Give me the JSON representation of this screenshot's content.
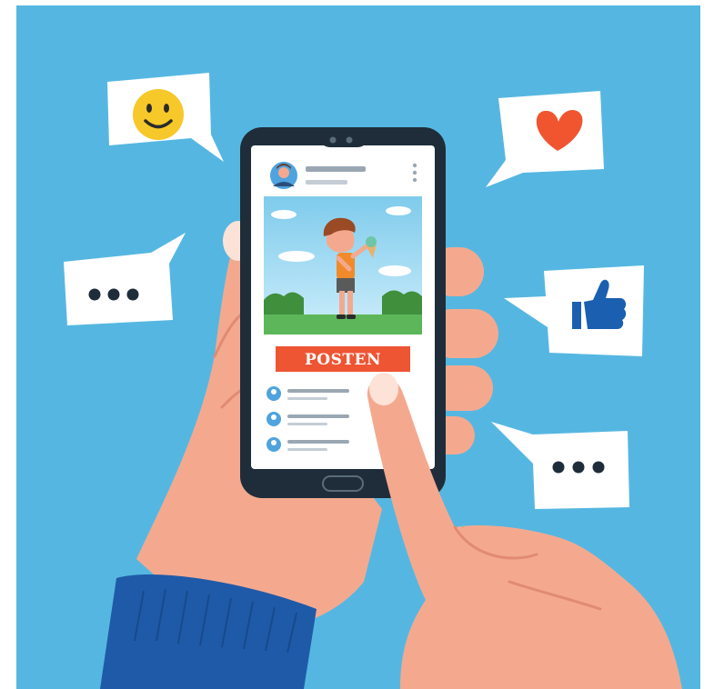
{
  "post_button": {
    "label": "POSTEN"
  },
  "bubbles": {
    "top_left": "smiley-face-icon",
    "top_right": "heart-icon",
    "middle_left": "ellipsis-icon",
    "middle_right": "thumbs-up-icon",
    "bottom_right": "ellipsis-icon"
  },
  "colors": {
    "background": "#55b7e1",
    "frame": "#ffffff",
    "phone_body": "#1f2d3a",
    "screen": "#ffffff",
    "post_button": "#ee5533",
    "post_button_text": "#ffffff",
    "skin": "#f4a98f",
    "skin_shadow": "#e08b72",
    "sleeve": "#1f5aa8",
    "heart": "#f0552f",
    "smiley": "#f7c829",
    "thumb": "#1b5fb0",
    "placeholder_line": "#9aa7b3",
    "avatar": "#4fa3de"
  }
}
